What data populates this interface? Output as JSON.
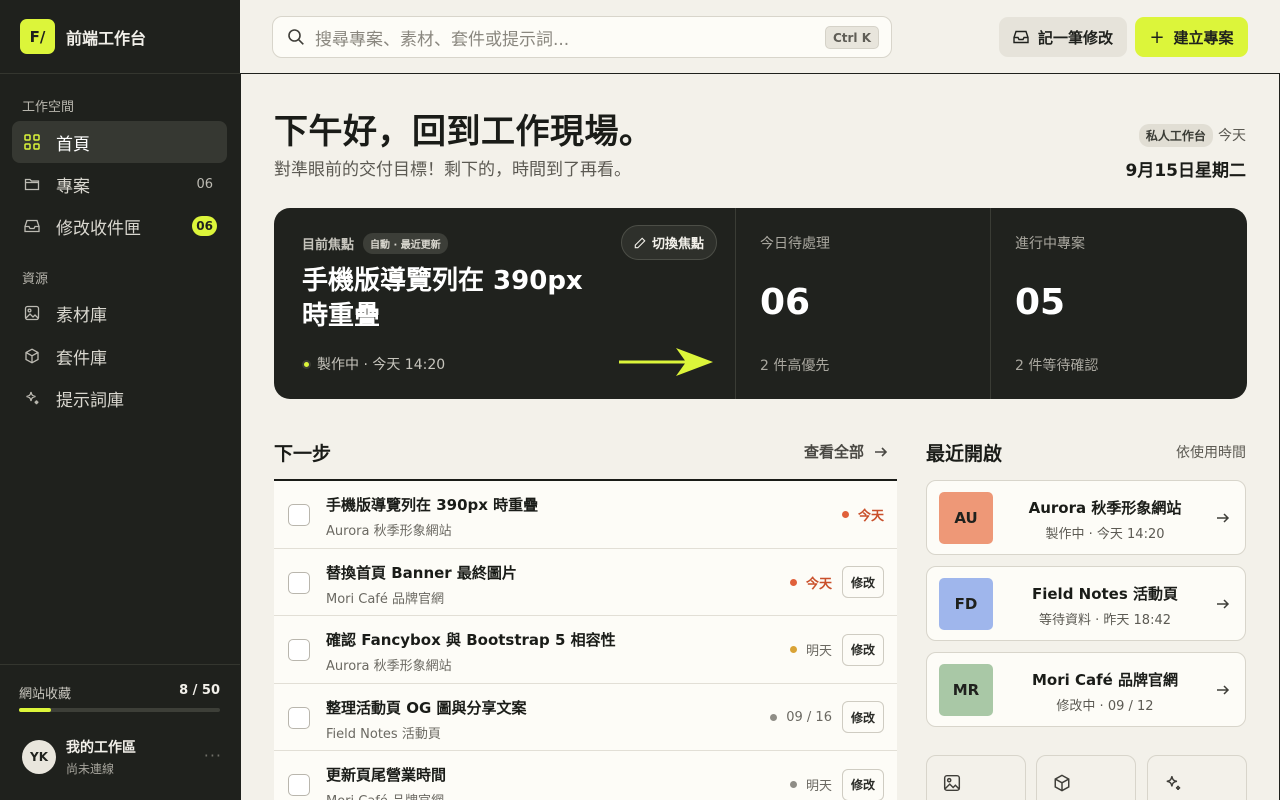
{
  "brand": {
    "logo": "F/",
    "name": "前端工作台"
  },
  "sidebar": {
    "section_workspace": "工作空間",
    "section_resources": "資源",
    "items": [
      {
        "label": "首頁",
        "icon": "grid-icon",
        "active": true
      },
      {
        "label": "專案",
        "icon": "folder-icon",
        "count": "06"
      },
      {
        "label": "修改收件匣",
        "icon": "inbox-icon",
        "badge": "06"
      },
      {
        "label": "素材庫",
        "icon": "image-icon"
      },
      {
        "label": "套件庫",
        "icon": "cube-icon"
      },
      {
        "label": "提示詞庫",
        "icon": "sparkle-icon"
      }
    ],
    "favorites": {
      "label": "網站收藏",
      "count": "8 / 50",
      "used": 8,
      "max": 50
    },
    "workspace": {
      "initials": "YK",
      "name": "我的工作區",
      "status": "尚未連線",
      "more": "···"
    }
  },
  "topbar": {
    "search_placeholder": "搜尋專案、素材、套件或提示詞...",
    "shortcut": "Ctrl K",
    "log_button": "記一筆修改",
    "new_button": "建立專案",
    "new_plus": "+"
  },
  "hero": {
    "greeting": "下午好，回到工作現場。",
    "subtitle": "對準眼前的交付目標！剩下的，時間到了再看。",
    "private_tag": "私人工作台",
    "today": "今天",
    "date": "9月15日星期二"
  },
  "focus": {
    "label": "目前焦點",
    "chip": "自動 · 最近更新",
    "switch_button": "切換焦點",
    "title": "手機版導覽列在 390px 時重疊",
    "status": "製作中 · 今天 14:20",
    "stats": [
      {
        "label": "今日待處理",
        "value": "06",
        "note": "2 件高優先"
      },
      {
        "label": "進行中專案",
        "value": "05",
        "note": "2 件等待確認"
      }
    ]
  },
  "next_steps": {
    "title": "下一步",
    "view_all": "查看全部",
    "tasks": [
      {
        "title": "手機版導覽列在 390px 時重疊",
        "project": "Aurora 秋季形象網站",
        "due": "今天",
        "urgent": true,
        "dot": "#e0603a",
        "action": ""
      },
      {
        "title": "替換首頁 Banner 最終圖片",
        "project": "Mori Café 品牌官網",
        "due": "今天",
        "urgent": true,
        "dot": "#e0603a",
        "action": "修改"
      },
      {
        "title": "確認 Fancybox 與 Bootstrap 5 相容性",
        "project": "Aurora 秋季形象網站",
        "due": "明天",
        "urgent": false,
        "dot": "#d9a336",
        "action": "修改"
      },
      {
        "title": "整理活動頁 OG 圖與分享文案",
        "project": "Field Notes 活動頁",
        "due": "09 / 16",
        "urgent": false,
        "dot": "#8f8d86",
        "action": "修改"
      },
      {
        "title": "更新頁尾營業時間",
        "project": "Mori Café 品牌官網",
        "due": "明天",
        "urgent": false,
        "dot": "#8f8d86",
        "action": "修改"
      }
    ]
  },
  "recent": {
    "title": "最近開啟",
    "sort": "依使用時間",
    "items": [
      {
        "initials": "AU",
        "color": "#ee9877",
        "name": "Aurora 秋季形象網站",
        "meta": "製作中 · 今天 14:20"
      },
      {
        "initials": "FD",
        "color": "#9fb6ec",
        "name": "Field Notes 活動頁",
        "meta": "等待資料 · 昨天 18:42"
      },
      {
        "initials": "MR",
        "color": "#a9c8a6",
        "name": "Mori Café 品牌官網",
        "meta": "修改中 · 09 / 12"
      }
    ],
    "shortcuts": [
      {
        "icon": "image-icon"
      },
      {
        "icon": "cube-icon"
      },
      {
        "icon": "sparkle-icon"
      }
    ]
  },
  "colors": {
    "accent": "#dcf53a",
    "sidebar": "#1f211d",
    "background": "#f3f1ea",
    "urgent": "#c9502b"
  }
}
